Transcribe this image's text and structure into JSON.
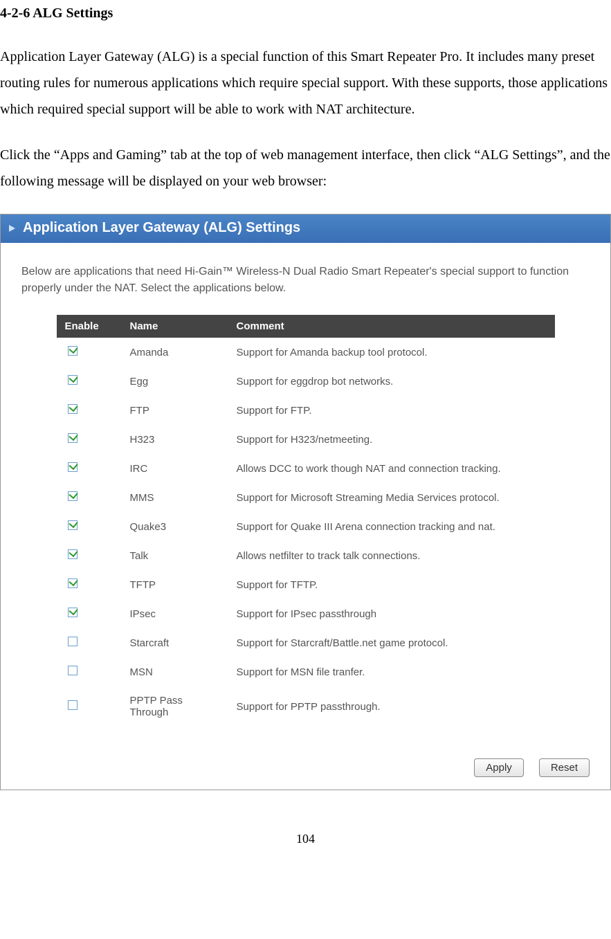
{
  "doc": {
    "heading": "4-2-6 ALG Settings",
    "para1": "Application Layer Gateway (ALG) is a special function of this Smart Repeater Pro. It includes many preset routing rules for numerous applications which require special support. With these supports, those applications which required special support will be able to work with NAT architecture.",
    "para2": "Click the “Apps and Gaming” tab at the top of web management interface, then click “ALG Settings”, and the following message will be displayed on your web browser:",
    "page_number": "104"
  },
  "panel": {
    "title": "Application Layer Gateway (ALG)  Settings",
    "description": "Below are applications that need Hi-Gain™ Wireless-N Dual Radio Smart Repeater's special support to function properly under the NAT. Select the applications below.",
    "headers": {
      "enable": "Enable",
      "name": "Name",
      "comment": "Comment"
    },
    "rows": [
      {
        "checked": true,
        "name": "Amanda",
        "comment": "Support for Amanda backup tool protocol."
      },
      {
        "checked": true,
        "name": "Egg",
        "comment": "Support for eggdrop bot networks."
      },
      {
        "checked": true,
        "name": "FTP",
        "comment": "Support for FTP."
      },
      {
        "checked": true,
        "name": "H323",
        "comment": "Support for H323/netmeeting."
      },
      {
        "checked": true,
        "name": "IRC",
        "comment": "Allows DCC to work though NAT and connection tracking."
      },
      {
        "checked": true,
        "name": "MMS",
        "comment": "Support for Microsoft Streaming Media Services protocol."
      },
      {
        "checked": true,
        "name": "Quake3",
        "comment": "Support for Quake III Arena connection tracking and nat."
      },
      {
        "checked": true,
        "name": "Talk",
        "comment": "Allows netfilter to track talk connections."
      },
      {
        "checked": true,
        "name": "TFTP",
        "comment": "Support for TFTP."
      },
      {
        "checked": true,
        "name": "IPsec",
        "comment": "Support for IPsec passthrough"
      },
      {
        "checked": false,
        "name": "Starcraft",
        "comment": "Support for Starcraft/Battle.net game protocol."
      },
      {
        "checked": false,
        "name": "MSN",
        "comment": "Support for MSN file tranfer."
      },
      {
        "checked": false,
        "name": "PPTP Pass Through",
        "comment": "Support for PPTP passthrough."
      }
    ],
    "apply_label": "Apply",
    "reset_label": "Reset"
  }
}
